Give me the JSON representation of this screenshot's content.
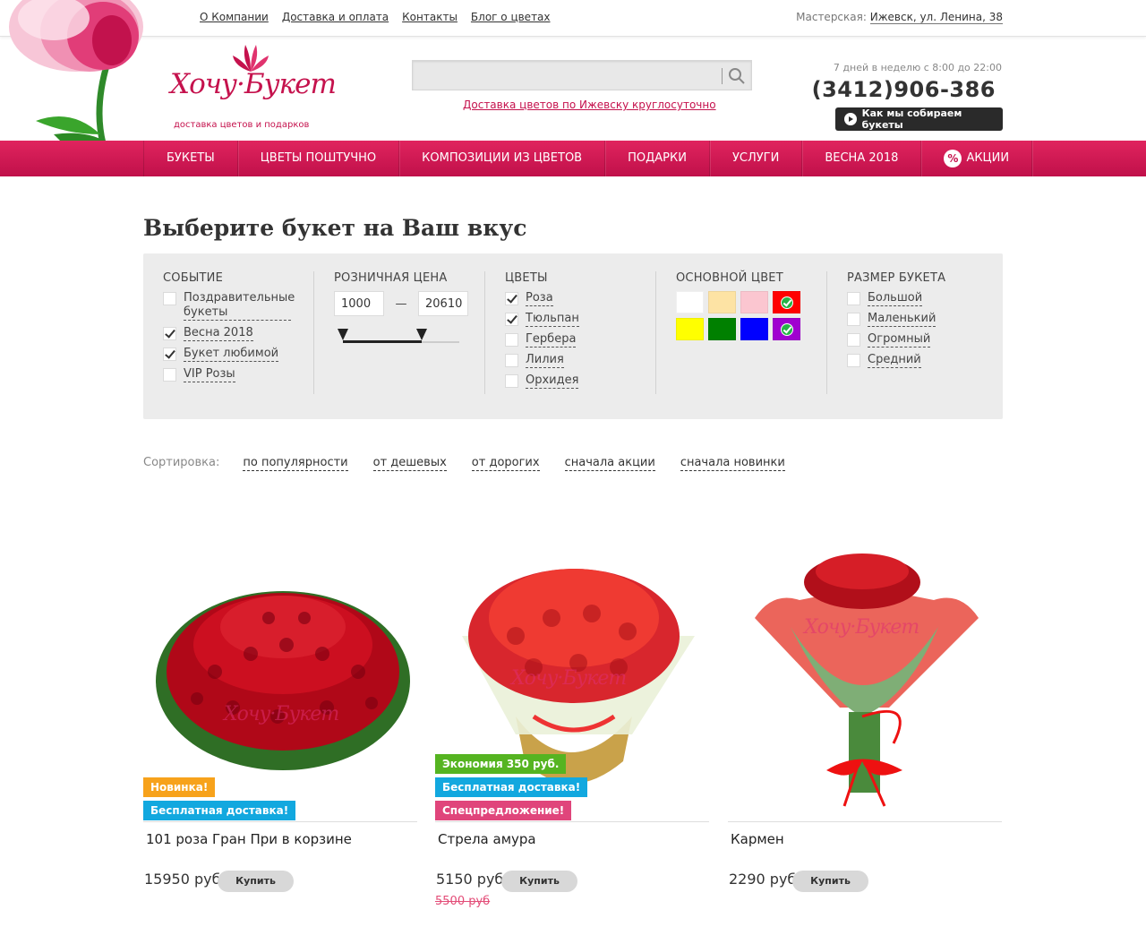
{
  "top_nav": [
    "О Компании",
    "Доставка и оплата",
    "Контакты",
    "Блог о цветах"
  ],
  "workshop": {
    "label": "Мастерская:",
    "address": "Ижевск, ул. Ленина, 38"
  },
  "logo": {
    "word": "Хочу·Букет",
    "sub": "доставка цветов и подарков"
  },
  "search": {
    "placeholder": "",
    "button": "search-icon"
  },
  "delivery_link": "Доставка цветов по Ижевску круглосуточно",
  "contacts": {
    "hours": "7 дней в неделю с 8:00 до 22:00",
    "phone": "(3412)906-386",
    "how_button": "Как мы собираем букеты"
  },
  "main_menu": [
    "БУКЕТЫ",
    "ЦВЕТЫ ПОШТУЧНО",
    "КОМПОЗИЦИИ ИЗ ЦВЕТОВ",
    "ПОДАРКИ",
    "УСЛУГИ",
    "ВЕСНА 2018",
    "АКЦИИ"
  ],
  "heading": "Выберите букет на Ваш вкус",
  "filters": {
    "event": {
      "title": "СОБЫТИЕ",
      "items": [
        {
          "label": "Поздравительные букеты",
          "checked": false
        },
        {
          "label": "Весна 2018",
          "checked": true
        },
        {
          "label": "Букет любимой",
          "checked": true
        },
        {
          "label": "VIP Розы",
          "checked": false
        }
      ]
    },
    "price": {
      "title": "РОЗНИЧНАЯ ЦЕНА",
      "min": "1000",
      "sep": "—",
      "max": "20610",
      "range_fraction": [
        0.0,
        0.68
      ]
    },
    "flowers": {
      "title": "ЦВЕТЫ",
      "items": [
        {
          "label": "Роза",
          "checked": true
        },
        {
          "label": "Тюльпан",
          "checked": true
        },
        {
          "label": "Гербера",
          "checked": false
        },
        {
          "label": "Лилия",
          "checked": false
        },
        {
          "label": "Орхидея",
          "checked": false
        }
      ]
    },
    "colors": {
      "title": "ОСНОВНОЙ ЦВЕТ",
      "swatches": [
        {
          "color": "#ffffff",
          "selected": false
        },
        {
          "color": "#fde3a4",
          "selected": false
        },
        {
          "color": "#fbc6d0",
          "selected": false
        },
        {
          "color": "#ff0000",
          "selected": true
        },
        {
          "color": "#ffff00",
          "selected": false
        },
        {
          "color": "#008000",
          "selected": false
        },
        {
          "color": "#0000ff",
          "selected": false
        },
        {
          "color": "#a000d0",
          "selected": true
        }
      ]
    },
    "size": {
      "title": "РАЗМЕР БУКЕТА",
      "items": [
        {
          "label": "Большой",
          "checked": false
        },
        {
          "label": "Маленький",
          "checked": false
        },
        {
          "label": "Огромный",
          "checked": false
        },
        {
          "label": "Средний",
          "checked": false
        }
      ]
    }
  },
  "sorting": {
    "label": "Сортировка:",
    "options": [
      "по популярности",
      "от дешевых",
      "от дорогих",
      "сначала акции",
      "сначала новинки"
    ]
  },
  "products": [
    {
      "name": "101 роза Гран При в корзине",
      "price": "15950 руб",
      "old_price": "",
      "buy": "Купить",
      "badges": [
        {
          "text": "Новинка!",
          "color": "#f7a21b"
        },
        {
          "text": "Бесплатная доставка!",
          "color": "#12a8df"
        }
      ]
    },
    {
      "name": "Стрела амура",
      "price": "5150 руб",
      "old_price": "5500 руб",
      "buy": "Купить",
      "badges": [
        {
          "text": "Экономия 350 руб.",
          "color": "#55b421"
        },
        {
          "text": "Бесплатная доставка!",
          "color": "#12a8df"
        },
        {
          "text": "Спецпредложение!",
          "color": "#e0457b"
        }
      ]
    },
    {
      "name": "Кармен",
      "price": "2290 руб",
      "old_price": "",
      "buy": "Купить",
      "badges": []
    }
  ],
  "watermark": "Хочу·Букет",
  "brand_color": "#c5124d"
}
